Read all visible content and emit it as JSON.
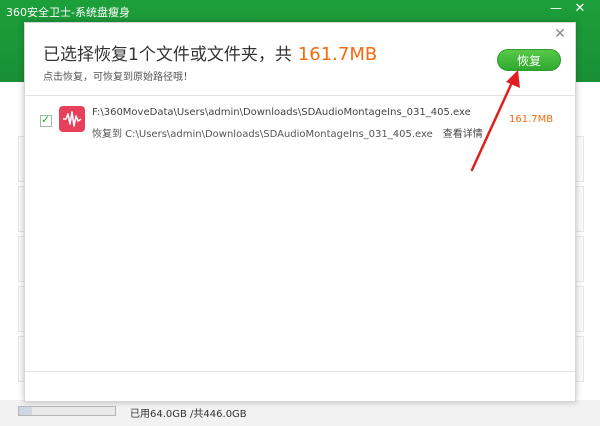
{
  "app": {
    "title": "360安全卫士-系统盘瘦身",
    "minimize_glyph": "—",
    "close_glyph": "✕"
  },
  "dialog": {
    "title_prefix": "已选择恢复1个文件或文件夹，共",
    "title_size": "161.7MB",
    "subtitle": "点击恢复，可恢复到原始路径哦！",
    "restore_button": "恢复",
    "close_glyph": "✕"
  },
  "file": {
    "checked": true,
    "icon": "audio-waveform-icon",
    "source_path": "F:\\360MoveData\\Users\\admin\\Downloads\\SDAudioMontageIns_031_405.exe",
    "restore_path": "恢复到 C:\\Users\\admin\\Downloads\\SDAudioMontageIns_031_405.exe",
    "details_link": "查看详情",
    "size": "161.7MB"
  },
  "disk": {
    "label": "已用64.0GB /共446.0GB",
    "used_fraction": 0.14
  },
  "colors": {
    "accent_green": "#2ea92f",
    "size_orange": "#f26b0f",
    "arrow_red": "#e02020"
  }
}
